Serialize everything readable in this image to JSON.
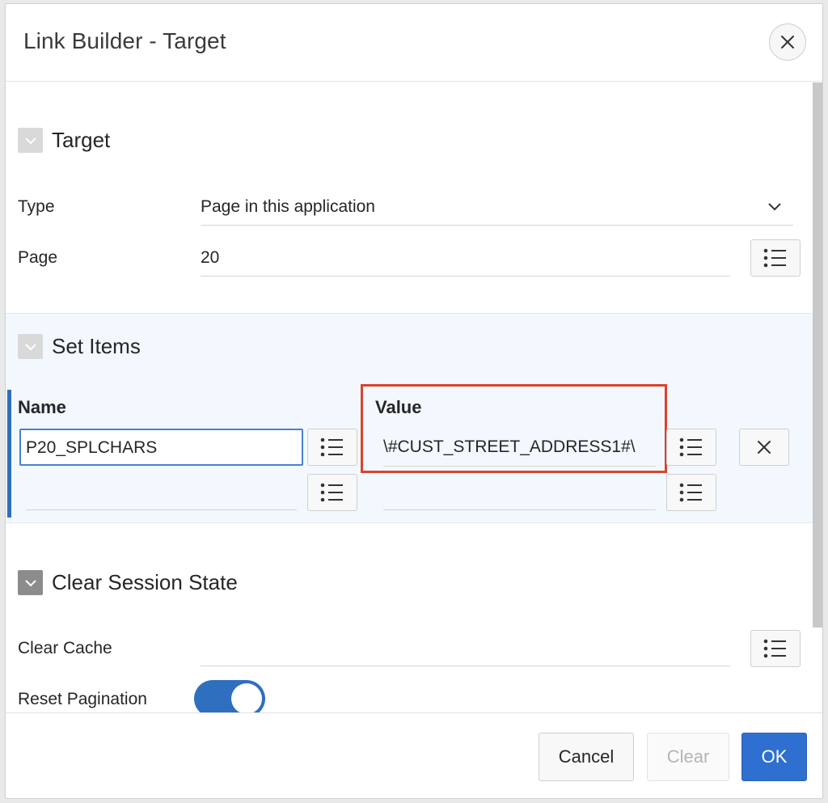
{
  "dialog": {
    "title": "Link Builder - Target",
    "close_icon": "close-icon"
  },
  "target": {
    "section_title": "Target",
    "type_label": "Type",
    "type_value": "Page in this application",
    "page_label": "Page",
    "page_value": "20"
  },
  "set_items": {
    "section_title": "Set Items",
    "name_header": "Name",
    "value_header": "Value",
    "rows": [
      {
        "name": "P20_SPLCHARS",
        "value": "\\#CUST_STREET_ADDRESS1#\\"
      },
      {
        "name": "",
        "value": ""
      }
    ]
  },
  "clear_session": {
    "section_title": "Clear Session State",
    "clear_cache_label": "Clear Cache",
    "clear_cache_value": "",
    "reset_pagination_label": "Reset Pagination",
    "reset_pagination_on": true
  },
  "footer": {
    "cancel_label": "Cancel",
    "clear_label": "Clear",
    "ok_label": "OK"
  },
  "colors": {
    "accent": "#2f6fcf",
    "highlight": "#d9442d",
    "set_items_bg": "#f2f8fd"
  }
}
